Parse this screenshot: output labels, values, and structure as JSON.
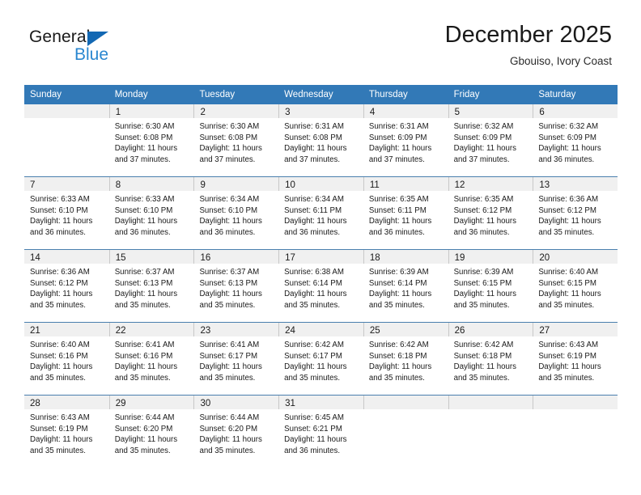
{
  "brand": {
    "name_top": "General",
    "name_bottom": "Blue",
    "triangle_icon": "triangle-icon",
    "color_dark": "#1a1a1a",
    "color_blue": "#2a87d0"
  },
  "header": {
    "title": "December 2025",
    "subtitle": "Gbouiso, Ivory Coast"
  },
  "theme": {
    "header_row_bg": "#3279b7",
    "day_band_bg": "#f0f0f0",
    "row_divider": "#4a7fae",
    "cell_divider": "#c8c8c8"
  },
  "calendar": {
    "weekdays": [
      "Sunday",
      "Monday",
      "Tuesday",
      "Wednesday",
      "Thursday",
      "Friday",
      "Saturday"
    ],
    "weeks": [
      [
        {
          "day": "",
          "lines": []
        },
        {
          "day": "1",
          "lines": [
            "Sunrise: 6:30 AM",
            "Sunset: 6:08 PM",
            "Daylight: 11 hours",
            "and 37 minutes."
          ]
        },
        {
          "day": "2",
          "lines": [
            "Sunrise: 6:30 AM",
            "Sunset: 6:08 PM",
            "Daylight: 11 hours",
            "and 37 minutes."
          ]
        },
        {
          "day": "3",
          "lines": [
            "Sunrise: 6:31 AM",
            "Sunset: 6:08 PM",
            "Daylight: 11 hours",
            "and 37 minutes."
          ]
        },
        {
          "day": "4",
          "lines": [
            "Sunrise: 6:31 AM",
            "Sunset: 6:09 PM",
            "Daylight: 11 hours",
            "and 37 minutes."
          ]
        },
        {
          "day": "5",
          "lines": [
            "Sunrise: 6:32 AM",
            "Sunset: 6:09 PM",
            "Daylight: 11 hours",
            "and 37 minutes."
          ]
        },
        {
          "day": "6",
          "lines": [
            "Sunrise: 6:32 AM",
            "Sunset: 6:09 PM",
            "Daylight: 11 hours",
            "and 36 minutes."
          ]
        }
      ],
      [
        {
          "day": "7",
          "lines": [
            "Sunrise: 6:33 AM",
            "Sunset: 6:10 PM",
            "Daylight: 11 hours",
            "and 36 minutes."
          ]
        },
        {
          "day": "8",
          "lines": [
            "Sunrise: 6:33 AM",
            "Sunset: 6:10 PM",
            "Daylight: 11 hours",
            "and 36 minutes."
          ]
        },
        {
          "day": "9",
          "lines": [
            "Sunrise: 6:34 AM",
            "Sunset: 6:10 PM",
            "Daylight: 11 hours",
            "and 36 minutes."
          ]
        },
        {
          "day": "10",
          "lines": [
            "Sunrise: 6:34 AM",
            "Sunset: 6:11 PM",
            "Daylight: 11 hours",
            "and 36 minutes."
          ]
        },
        {
          "day": "11",
          "lines": [
            "Sunrise: 6:35 AM",
            "Sunset: 6:11 PM",
            "Daylight: 11 hours",
            "and 36 minutes."
          ]
        },
        {
          "day": "12",
          "lines": [
            "Sunrise: 6:35 AM",
            "Sunset: 6:12 PM",
            "Daylight: 11 hours",
            "and 36 minutes."
          ]
        },
        {
          "day": "13",
          "lines": [
            "Sunrise: 6:36 AM",
            "Sunset: 6:12 PM",
            "Daylight: 11 hours",
            "and 35 minutes."
          ]
        }
      ],
      [
        {
          "day": "14",
          "lines": [
            "Sunrise: 6:36 AM",
            "Sunset: 6:12 PM",
            "Daylight: 11 hours",
            "and 35 minutes."
          ]
        },
        {
          "day": "15",
          "lines": [
            "Sunrise: 6:37 AM",
            "Sunset: 6:13 PM",
            "Daylight: 11 hours",
            "and 35 minutes."
          ]
        },
        {
          "day": "16",
          "lines": [
            "Sunrise: 6:37 AM",
            "Sunset: 6:13 PM",
            "Daylight: 11 hours",
            "and 35 minutes."
          ]
        },
        {
          "day": "17",
          "lines": [
            "Sunrise: 6:38 AM",
            "Sunset: 6:14 PM",
            "Daylight: 11 hours",
            "and 35 minutes."
          ]
        },
        {
          "day": "18",
          "lines": [
            "Sunrise: 6:39 AM",
            "Sunset: 6:14 PM",
            "Daylight: 11 hours",
            "and 35 minutes."
          ]
        },
        {
          "day": "19",
          "lines": [
            "Sunrise: 6:39 AM",
            "Sunset: 6:15 PM",
            "Daylight: 11 hours",
            "and 35 minutes."
          ]
        },
        {
          "day": "20",
          "lines": [
            "Sunrise: 6:40 AM",
            "Sunset: 6:15 PM",
            "Daylight: 11 hours",
            "and 35 minutes."
          ]
        }
      ],
      [
        {
          "day": "21",
          "lines": [
            "Sunrise: 6:40 AM",
            "Sunset: 6:16 PM",
            "Daylight: 11 hours",
            "and 35 minutes."
          ]
        },
        {
          "day": "22",
          "lines": [
            "Sunrise: 6:41 AM",
            "Sunset: 6:16 PM",
            "Daylight: 11 hours",
            "and 35 minutes."
          ]
        },
        {
          "day": "23",
          "lines": [
            "Sunrise: 6:41 AM",
            "Sunset: 6:17 PM",
            "Daylight: 11 hours",
            "and 35 minutes."
          ]
        },
        {
          "day": "24",
          "lines": [
            "Sunrise: 6:42 AM",
            "Sunset: 6:17 PM",
            "Daylight: 11 hours",
            "and 35 minutes."
          ]
        },
        {
          "day": "25",
          "lines": [
            "Sunrise: 6:42 AM",
            "Sunset: 6:18 PM",
            "Daylight: 11 hours",
            "and 35 minutes."
          ]
        },
        {
          "day": "26",
          "lines": [
            "Sunrise: 6:42 AM",
            "Sunset: 6:18 PM",
            "Daylight: 11 hours",
            "and 35 minutes."
          ]
        },
        {
          "day": "27",
          "lines": [
            "Sunrise: 6:43 AM",
            "Sunset: 6:19 PM",
            "Daylight: 11 hours",
            "and 35 minutes."
          ]
        }
      ],
      [
        {
          "day": "28",
          "lines": [
            "Sunrise: 6:43 AM",
            "Sunset: 6:19 PM",
            "Daylight: 11 hours",
            "and 35 minutes."
          ]
        },
        {
          "day": "29",
          "lines": [
            "Sunrise: 6:44 AM",
            "Sunset: 6:20 PM",
            "Daylight: 11 hours",
            "and 35 minutes."
          ]
        },
        {
          "day": "30",
          "lines": [
            "Sunrise: 6:44 AM",
            "Sunset: 6:20 PM",
            "Daylight: 11 hours",
            "and 35 minutes."
          ]
        },
        {
          "day": "31",
          "lines": [
            "Sunrise: 6:45 AM",
            "Sunset: 6:21 PM",
            "Daylight: 11 hours",
            "and 36 minutes."
          ]
        },
        {
          "day": "",
          "lines": []
        },
        {
          "day": "",
          "lines": []
        },
        {
          "day": "",
          "lines": []
        }
      ]
    ]
  }
}
